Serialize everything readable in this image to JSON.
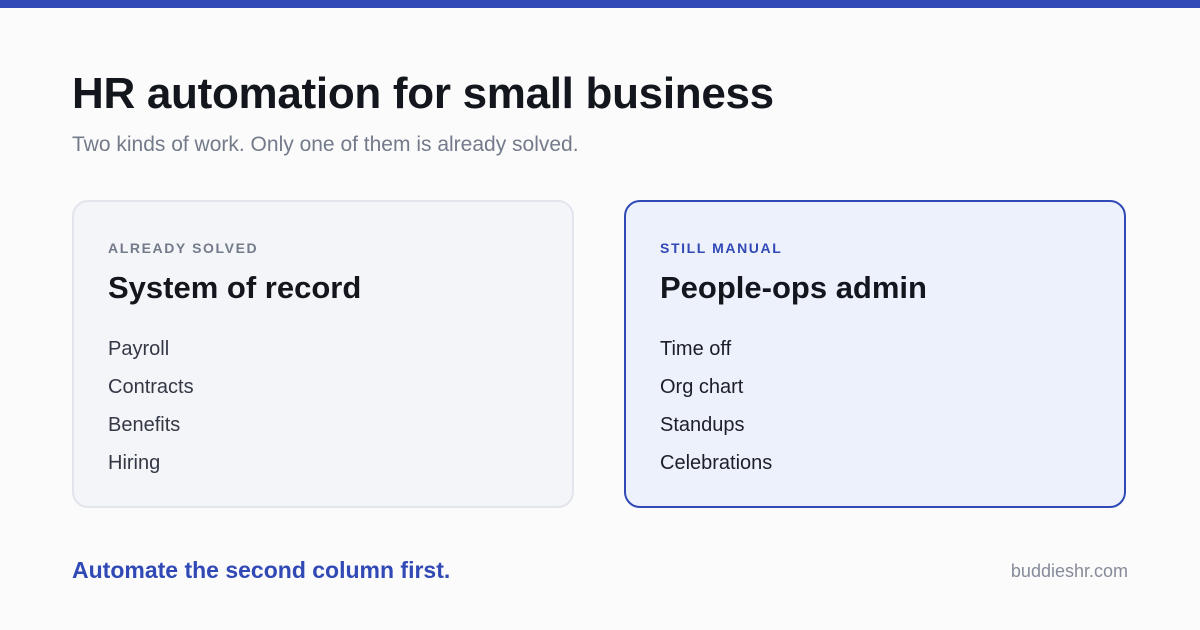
{
  "colors": {
    "accent": "#3049b5",
    "background": "#fbfbfc",
    "title": "#14161d",
    "muted": "#737a89"
  },
  "header": {
    "title": "HR automation for small business",
    "subtitle": "Two kinds of work. Only one of them is already solved."
  },
  "columns": [
    {
      "eyebrow": "ALREADY SOLVED",
      "title": "System of record",
      "items": [
        "Payroll",
        "Contracts",
        "Benefits",
        "Hiring"
      ]
    },
    {
      "eyebrow": "STILL MANUAL",
      "title": "People-ops admin",
      "items": [
        "Time off",
        "Org chart",
        "Standups",
        "Celebrations"
      ]
    }
  ],
  "footer": {
    "cta": "Automate the second column first.",
    "domain": "buddieshr.com"
  }
}
